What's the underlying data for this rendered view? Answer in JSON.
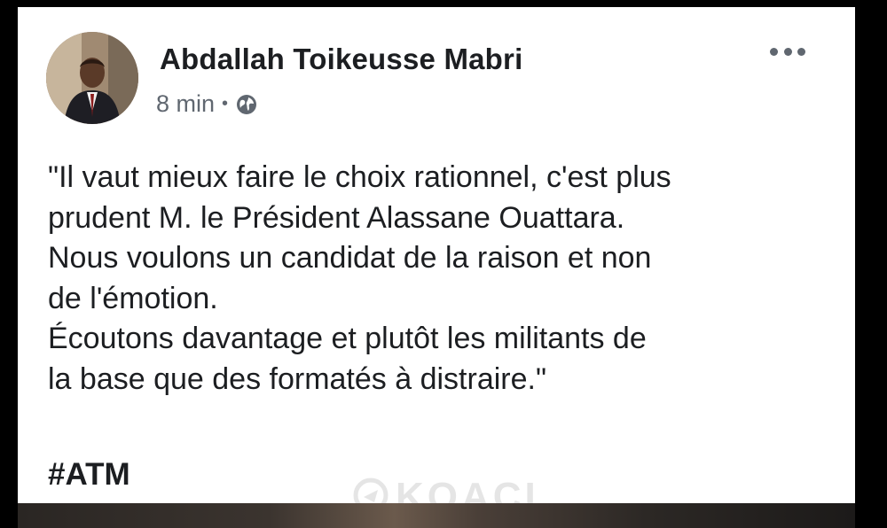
{
  "post": {
    "author": "Abdallah Toikeusse Mabri",
    "time": "8 min",
    "separator": "•",
    "privacy_icon": "globe-icon",
    "more_icon": "more-options-icon",
    "text_lines": [
      "\"Il vaut mieux faire le choix rationnel, c'est plus",
      "prudent M. le Président Alassane Ouattara.",
      "Nous voulons un candidat de la raison et non",
      "de l'émotion.",
      "Écoutons davantage et plutôt les militants de",
      "la base que des formatés à distraire.\""
    ],
    "hashtag": "#ATM"
  },
  "watermark": {
    "text": "KOACI",
    "logo_icon": "koaci-logo-icon"
  }
}
